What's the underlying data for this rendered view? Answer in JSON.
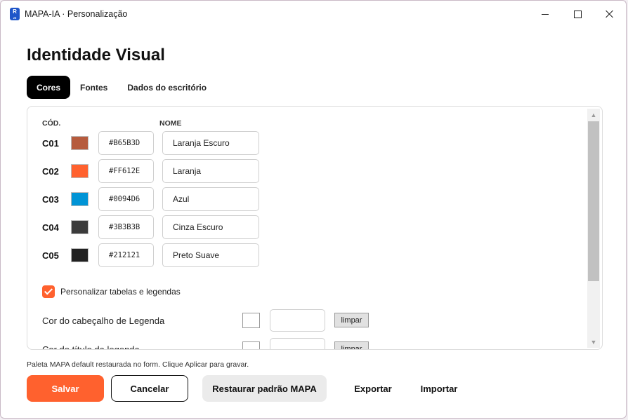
{
  "window": {
    "title": "MAPA-IA · Personalização",
    "app_icon_letter": "R",
    "app_icon_sub": "25"
  },
  "page": {
    "title": "Identidade Visual"
  },
  "tabs": [
    {
      "label": "Cores",
      "active": true
    },
    {
      "label": "Fontes",
      "active": false
    },
    {
      "label": "Dados do escritório",
      "active": false
    }
  ],
  "table": {
    "header_code": "CÓD.",
    "header_name": "NOME"
  },
  "colors": [
    {
      "code": "C01",
      "hex": "#B65B3D",
      "name": "Laranja Escuro"
    },
    {
      "code": "C02",
      "hex": "#FF612E",
      "name": "Laranja"
    },
    {
      "code": "C03",
      "hex": "#0094D6",
      "name": "Azul"
    },
    {
      "code": "C04",
      "hex": "#3B3B3B",
      "name": "Cinza Escuro"
    },
    {
      "code": "C05",
      "hex": "#212121",
      "name": "Preto Suave"
    }
  ],
  "customize": {
    "label": "Personalizar tabelas e legendas",
    "checked": true
  },
  "legend_rows": [
    {
      "label": "Cor do cabeçalho de Legenda",
      "value": "",
      "clear_label": "limpar"
    },
    {
      "label": "Cor do título da legenda",
      "value": "",
      "clear_label": "limpar"
    }
  ],
  "status": "Paleta MAPA default restaurada no form. Clique Aplicar para gravar.",
  "buttons": {
    "save": "Salvar",
    "cancel": "Cancelar",
    "restore": "Restaurar padrão MAPA",
    "export": "Exportar",
    "import": "Importar"
  },
  "accent_color": "#FF612E"
}
